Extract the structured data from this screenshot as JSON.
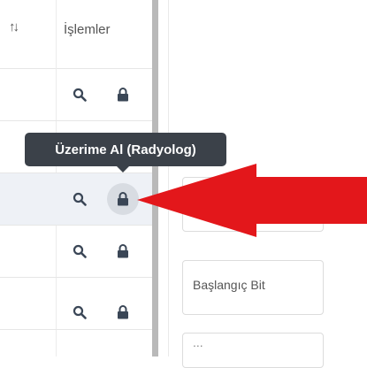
{
  "table": {
    "sort_icon": "↑↓",
    "actions_header": "İşlemler",
    "rows": [
      {
        "search_icon": "search-icon",
        "lock_icon": "lock-icon",
        "highlighted": false
      },
      {
        "search_icon": "search-icon",
        "lock_icon": "lock-icon",
        "highlighted": false
      },
      {
        "search_icon": "search-icon",
        "lock_icon": "lock-icon",
        "highlighted": true
      },
      {
        "search_icon": "search-icon",
        "lock_icon": "lock-icon",
        "highlighted": false
      },
      {
        "search_icon": "search-icon",
        "lock_icon": "lock-icon",
        "highlighted": false
      }
    ]
  },
  "tooltip": {
    "text": "Üzerime Al (Radyolog)"
  },
  "form": {
    "start_field_label": "Başlangıç Bit",
    "bottom_field_label": "..."
  },
  "colors": {
    "arrow": "#e3171b",
    "tooltip_bg": "#3b4149",
    "icon": "#3a4656",
    "highlight_row": "#eef1f6"
  }
}
